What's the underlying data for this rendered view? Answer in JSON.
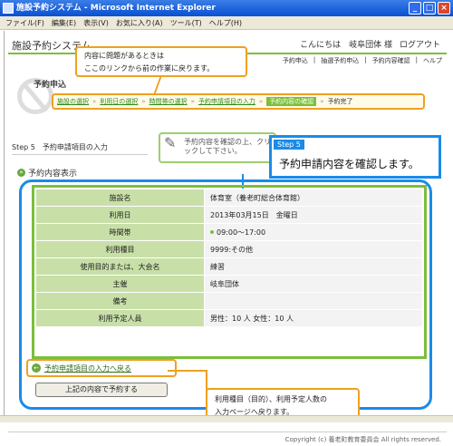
{
  "window": {
    "title": "施設予約システム - Microsoft Internet Explorer"
  },
  "menu": [
    "ファイル(F)",
    "編集(E)",
    "表示(V)",
    "お気に入り(A)",
    "ツール(T)",
    "ヘルプ(H)"
  ],
  "header": {
    "app_name": "施設予約システム",
    "greeting": "こんにちは　岐阜団体 様",
    "logout": "ログアウト"
  },
  "topnav": [
    "予約申込",
    "抽選予約申込",
    "予約内容確認",
    "ヘルプ"
  ],
  "page_heading": "予約申込",
  "steps": [
    {
      "label": "施設の選択"
    },
    {
      "label": "利用日の選択"
    },
    {
      "label": "時間帯の選択"
    },
    {
      "label": "予約申請項目の入力"
    },
    {
      "label": "予約内容の確認"
    },
    {
      "label": "予約完了"
    }
  ],
  "callout_top": {
    "line1": "内容に問題があるときは",
    "line2": "ここのリンクから前の作業に戻ります。"
  },
  "step_header": "Step 5　予約申請項目の入力",
  "hint": "予約内容を確認の上、クリックして下さい。",
  "blue_callout": {
    "tag": "Step 5",
    "message": "予約申請内容を確認します。"
  },
  "section_title": "予約内容表示",
  "rows": [
    {
      "label": "施設名",
      "value": "体育室（養老町総合体育館）"
    },
    {
      "label": "利用日",
      "value": "2013年03月15日　金曜日"
    },
    {
      "label": "時間帯",
      "value": "09:00～17:00"
    },
    {
      "label": "利用種目",
      "value": "9999:その他"
    },
    {
      "label": "使用目的または、大会名",
      "value": "練習"
    },
    {
      "label": "主催",
      "value": "岐阜団体"
    },
    {
      "label": "備考",
      "value": ""
    },
    {
      "label": "利用予定人員",
      "value": "男性：10 人 女性：10 人"
    }
  ],
  "back_link": "予約申請項目の入力へ戻る",
  "submit_button": "上記の内容で予約する",
  "callout_bottom": {
    "line1": "利用種目（目的）、利用予定人数の",
    "line2": "入力ページへ戻ります。"
  },
  "footer": "Copyright (c) 養老町教育委員会 All rights reserved.",
  "colors": {
    "accent_green": "#7bbf3a",
    "callout_orange": "#f0a020",
    "callout_blue": "#1a8be8"
  }
}
